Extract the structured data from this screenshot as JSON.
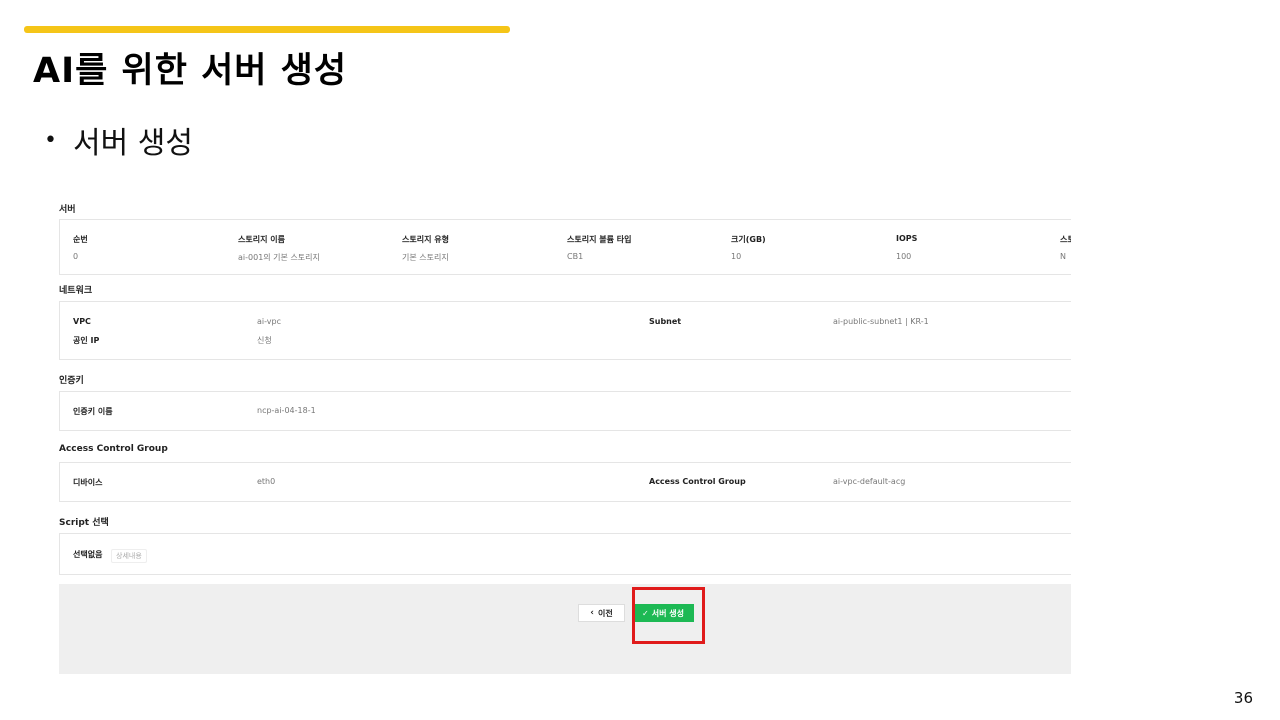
{
  "slide": {
    "title": "AI를 위한 서버 생성",
    "bullet": "서버 생성",
    "page_number": "36",
    "accent_color": "#f5c518",
    "highlight_color": "#e01b1b"
  },
  "server_section": {
    "title": "서버",
    "headers": [
      "순번",
      "스토리지 이름",
      "스토리지 유형",
      "스토리지 볼륨 타입",
      "크기(GB)",
      "IOPS",
      "스토"
    ],
    "values": [
      "0",
      "ai-001의 기본 스토리지",
      "기본 스토리지",
      "CB1",
      "10",
      "100",
      "N"
    ]
  },
  "network_section": {
    "title": "네트워크",
    "vpc_label": "VPC",
    "vpc_value": "ai-vpc",
    "subnet_label": "Subnet",
    "subnet_value": "ai-public-subnet1 | KR-1",
    "public_ip_label": "공인 IP",
    "public_ip_value": "신청"
  },
  "auth_key_section": {
    "title": "인증키",
    "label": "인증키 이름",
    "value": "ncp-ai-04-18-1"
  },
  "acg_section": {
    "title": "Access Control Group",
    "device_label": "디바이스",
    "device_value": "eth0",
    "acg_label": "Access Control Group",
    "acg_value": "ai-vpc-default-acg"
  },
  "script_section": {
    "title": "Script 선택",
    "label": "선택없음",
    "detail_tag": "상세내용"
  },
  "footer": {
    "prev_label": "이전",
    "create_label": "서버 생성",
    "primary_color": "#1db954"
  }
}
